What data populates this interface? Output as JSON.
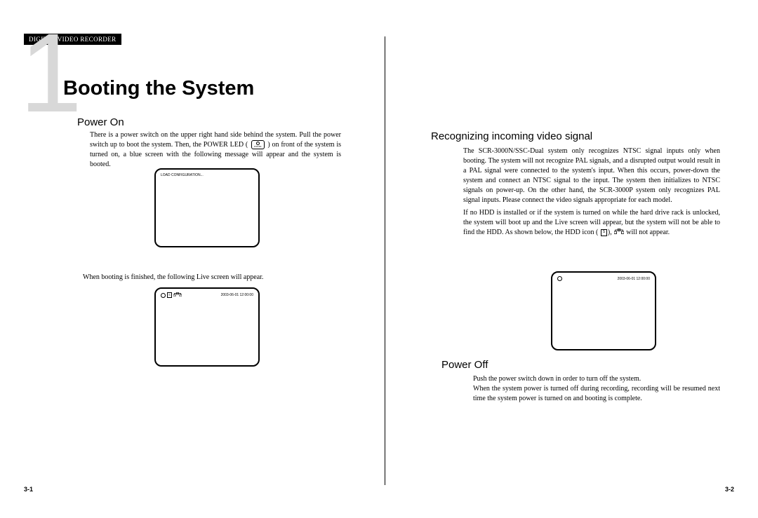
{
  "header": {
    "tag": "DIGITAL VIDEO RECORDER",
    "chapter_number_glyph": "1",
    "chapter_title": "Booting the System"
  },
  "left": {
    "power_on_heading": "Power On",
    "power_on_body_1": "There is a power switch on the upper right hand side behind the system. Pull the power switch up to boot the system. Then, the POWER LED (",
    "power_on_led_label": "POWER",
    "power_on_body_2": ") on front of the system is turned on, a blue screen with the following message will appear and the system is booted.",
    "screen1_text": "LOAD CONFIGURATION...",
    "live_caption": "When booting is finished, the following Live screen will appear.",
    "screen2_timestamp": "2003-06-01 12:00:00"
  },
  "right": {
    "recog_heading": "Recognizing incoming video signal",
    "recog_body_1": "The SCR-3000N/SSC-Dual system only recognizes NTSC signal inputs only when booting. The system will not recognize PAL signals, and a disrupted output would result in a PAL signal were connected to the system's input. When this occurs, power-down the system and connect an NTSC signal to the input. The system then initializes to NTSC signals on power-up. On the other hand, the SCR-3000P system only recognizes PAL signal inputs. Please connect the video signals  appropriate for each model.",
    "recog_body_2a": "If no HDD is installed or if the system is turned on while the hard drive rack is unlocked, the system will boot up and the Live screen will appear, but the system will not be able to find the HDD. As shown below, the HDD icon (",
    "recog_body_2b": "),",
    "recog_body_2c": "will not appear.",
    "hdd_glyph": "S",
    "screen3_timestamp": "2003-06-01 12:00:00",
    "power_off_heading": "Power Off",
    "power_off_body_1": "Push the power switch down in order to turn off the system.",
    "power_off_body_2": "When the system power is turned off during recording, recording will be resumed next time the system power is turned on and booting is complete."
  },
  "footer": {
    "page_left": "3-1",
    "page_right": "3-2"
  }
}
